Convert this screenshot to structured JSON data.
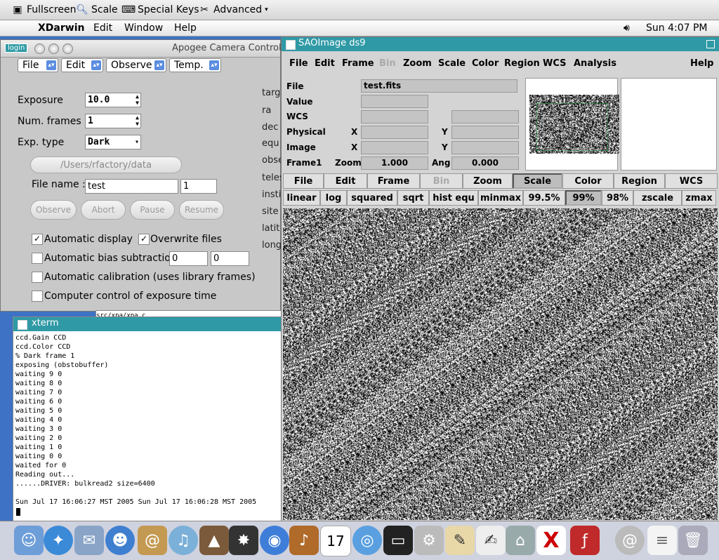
{
  "toolbar": {
    "fullscreen": "Fullscreen",
    "scale": "Scale",
    "special_keys": "Special Keys",
    "advanced": "Advanced"
  },
  "menubar": {
    "app": "XDarwin",
    "items": [
      "Edit",
      "Window",
      "Help"
    ],
    "clock": "Sun 4:07 PM"
  },
  "apogee": {
    "title": "Apogee Camera Control",
    "login": "login",
    "menus": [
      "File",
      "Edit",
      "Observe",
      "Temp."
    ],
    "exposure_label": "Exposure",
    "exposure_value": "10.0",
    "num_frames_label": "Num. frames",
    "num_frames_value": "1",
    "exp_type_label": "Exp. type",
    "exp_type_value": "Dark",
    "path_button": "/Users/rfactory/data",
    "file_name_label": "File name :",
    "file_name_value": "test",
    "file_index_value": "1",
    "buttons": [
      "Observe",
      "Abort",
      "Pause",
      "Resume"
    ],
    "auto_display": "Automatic display",
    "overwrite": "Overwrite files",
    "auto_bias": "Automatic bias subtraction",
    "bias_a": "0",
    "bias_b": "0",
    "auto_calib": "Automatic calibration (uses library frames)",
    "computer_control": "Computer control of exposure time",
    "side_labels": [
      "targ",
      "ra",
      "dec",
      "equ",
      "obse",
      "teles",
      "insti",
      "site",
      "latit",
      "long"
    ]
  },
  "xterm": {
    "title": "xterm",
    "hidden_path": "src/xpa/xpa.c",
    "lines": [
      "ccd.Gain CCD",
      "ccd.Color CCD",
      "% Dark frame 1",
      "exposing (obstobuffer)",
      "waiting 9 0",
      "waiting 8 0",
      "waiting 7 0",
      "waiting 6 0",
      "waiting 5 0",
      "waiting 4 0",
      "waiting 3 0",
      "waiting 2 0",
      "waiting 1 0",
      "waiting 0 0",
      "waited for 0",
      "Reading out...",
      "......DRIVER: bulkread2 size=6400",
      "",
      "Sun Jul 17 16:06:27 MST 2005 Sun Jul 17 16:06:28 MST 2005"
    ]
  },
  "ds9": {
    "title": "SAOImage ds9",
    "menus": [
      "File",
      "Edit",
      "Frame",
      "Bin",
      "Zoom",
      "Scale",
      "Color",
      "Region",
      "WCS",
      "Analysis",
      "Help"
    ],
    "info": {
      "file_label": "File",
      "file_value": "test.fits",
      "value_label": "Value",
      "wcs_label": "WCS",
      "physical_label": "Physical",
      "image_label": "Image",
      "frame_label": "Frame1",
      "x_label": "X",
      "y_label": "Y",
      "zoom_label": "Zoom",
      "zoom_value": "1.000",
      "ang_label": "Ang",
      "ang_value": "0.000"
    },
    "button_row1": [
      "File",
      "Edit",
      "Frame",
      "Bin",
      "Zoom",
      "Scale",
      "Color",
      "Region",
      "WCS"
    ],
    "button_row2": [
      "linear",
      "log",
      "squared",
      "sqrt",
      "hist equ",
      "minmax",
      "99.5%",
      "99%",
      "98%",
      "zscale",
      "zmax"
    ]
  },
  "dock": {
    "calendar_day": "17"
  }
}
